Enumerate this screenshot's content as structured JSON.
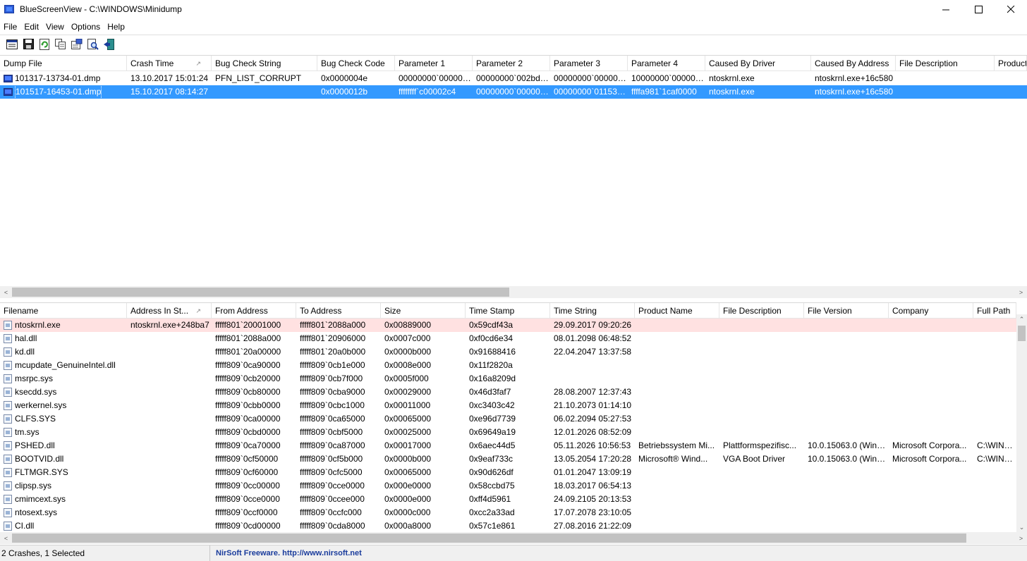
{
  "window": {
    "title": "BlueScreenView  -  C:\\WINDOWS\\Minidump",
    "minimize_glyph": "—",
    "maximize_glyph": "☐",
    "close_glyph": "✕"
  },
  "menu": {
    "items": [
      "File",
      "Edit",
      "View",
      "Options",
      "Help"
    ]
  },
  "toolbar": {
    "buttons": [
      "properties-list-icon",
      "save-icon",
      "refresh-icon",
      "copy-icon",
      "advanced-options-icon",
      "find-icon",
      "exit-icon"
    ]
  },
  "crash_list": {
    "columns": [
      {
        "label": "Dump File"
      },
      {
        "label": "Crash Time",
        "sort": "↗"
      },
      {
        "label": "Bug Check String"
      },
      {
        "label": "Bug Check Code"
      },
      {
        "label": "Parameter 1"
      },
      {
        "label": "Parameter 2"
      },
      {
        "label": "Parameter 3"
      },
      {
        "label": "Parameter 4"
      },
      {
        "label": "Caused By Driver"
      },
      {
        "label": "Caused By Address"
      },
      {
        "label": "File Description"
      },
      {
        "label": "Product"
      }
    ],
    "rows": [
      {
        "selected": false,
        "cells": [
          "101317-13734-01.dmp",
          "13.10.2017 15:01:24",
          "PFN_LIST_CORRUPT",
          "0x0000004e",
          "00000000`000000...",
          "00000000`002bde...",
          "00000000`000000...",
          "10000000`000000...",
          "ntoskrnl.exe",
          "ntoskrnl.exe+16c580",
          "",
          ""
        ]
      },
      {
        "selected": true,
        "cells": [
          "101517-16453-01.dmp",
          "15.10.2017 08:14:27",
          "",
          "0x0000012b",
          "ffffffff`c00002c4",
          "00000000`000008...",
          "00000000`01153a...",
          "ffffa981`1caf0000",
          "ntoskrnl.exe",
          "ntoskrnl.exe+16c580",
          "",
          ""
        ]
      }
    ]
  },
  "driver_list": {
    "columns": [
      {
        "label": "Filename"
      },
      {
        "label": "Address In St...",
        "sort": "↗"
      },
      {
        "label": "From Address"
      },
      {
        "label": "To Address"
      },
      {
        "label": "Size"
      },
      {
        "label": "Time Stamp"
      },
      {
        "label": "Time String"
      },
      {
        "label": "Product Name"
      },
      {
        "label": "File Description"
      },
      {
        "label": "File Version"
      },
      {
        "label": "Company"
      },
      {
        "label": "Full Path"
      }
    ],
    "rows": [
      {
        "highlight": true,
        "cells": [
          "ntoskrnl.exe",
          "ntoskrnl.exe+248ba7",
          "fffff801`20001000",
          "fffff801`2088a000",
          "0x00889000",
          "0x59cdf43a",
          "29.09.2017 09:20:26",
          "",
          "",
          "",
          "",
          ""
        ]
      },
      {
        "highlight": false,
        "cells": [
          "hal.dll",
          "",
          "fffff801`2088a000",
          "fffff801`20906000",
          "0x0007c000",
          "0xf0cd6e34",
          "08.01.2098 06:48:52",
          "",
          "",
          "",
          "",
          ""
        ]
      },
      {
        "highlight": false,
        "cells": [
          "kd.dll",
          "",
          "fffff801`20a00000",
          "fffff801`20a0b000",
          "0x0000b000",
          "0x91688416",
          "22.04.2047 13:37:58",
          "",
          "",
          "",
          "",
          ""
        ]
      },
      {
        "highlight": false,
        "cells": [
          "mcupdate_GenuineIntel.dll",
          "",
          "fffff809`0ca90000",
          "fffff809`0cb1e000",
          "0x0008e000",
          "0x11f2820a",
          "",
          "",
          "",
          "",
          "",
          ""
        ]
      },
      {
        "highlight": false,
        "cells": [
          "msrpc.sys",
          "",
          "fffff809`0cb20000",
          "fffff809`0cb7f000",
          "0x0005f000",
          "0x16a8209d",
          "",
          "",
          "",
          "",
          "",
          ""
        ]
      },
      {
        "highlight": false,
        "cells": [
          "ksecdd.sys",
          "",
          "fffff809`0cb80000",
          "fffff809`0cba9000",
          "0x00029000",
          "0x46d3faf7",
          "28.08.2007 12:37:43",
          "",
          "",
          "",
          "",
          ""
        ]
      },
      {
        "highlight": false,
        "cells": [
          "werkernel.sys",
          "",
          "fffff809`0cbb0000",
          "fffff809`0cbc1000",
          "0x00011000",
          "0xc3403c42",
          "21.10.2073 01:14:10",
          "",
          "",
          "",
          "",
          ""
        ]
      },
      {
        "highlight": false,
        "cells": [
          "CLFS.SYS",
          "",
          "fffff809`0ca00000",
          "fffff809`0ca65000",
          "0x00065000",
          "0xe96d7739",
          "06.02.2094 05:27:53",
          "",
          "",
          "",
          "",
          ""
        ]
      },
      {
        "highlight": false,
        "cells": [
          "tm.sys",
          "",
          "fffff809`0cbd0000",
          "fffff809`0cbf5000",
          "0x00025000",
          "0x69649a19",
          "12.01.2026 08:52:09",
          "",
          "",
          "",
          "",
          ""
        ]
      },
      {
        "highlight": false,
        "cells": [
          "PSHED.dll",
          "",
          "fffff809`0ca70000",
          "fffff809`0ca87000",
          "0x00017000",
          "0x6aec44d5",
          "05.11.2026 10:56:53",
          "Betriebssystem Mi...",
          "Plattformspezifisc...",
          "10.0.15063.0 (WinB...",
          "Microsoft Corpora...",
          "C:\\WINDO"
        ]
      },
      {
        "highlight": false,
        "cells": [
          "BOOTVID.dll",
          "",
          "fffff809`0cf50000",
          "fffff809`0cf5b000",
          "0x0000b000",
          "0x9eaf733c",
          "13.05.2054 17:20:28",
          "Microsoft® Wind...",
          "VGA Boot Driver",
          "10.0.15063.0 (WinB...",
          "Microsoft Corpora...",
          "C:\\WINDO"
        ]
      },
      {
        "highlight": false,
        "cells": [
          "FLTMGR.SYS",
          "",
          "fffff809`0cf60000",
          "fffff809`0cfc5000",
          "0x00065000",
          "0x90d626df",
          "01.01.2047 13:09:19",
          "",
          "",
          "",
          "",
          ""
        ]
      },
      {
        "highlight": false,
        "cells": [
          "clipsp.sys",
          "",
          "fffff809`0cc00000",
          "fffff809`0cce0000",
          "0x000e0000",
          "0x58ccbd75",
          "18.03.2017 06:54:13",
          "",
          "",
          "",
          "",
          ""
        ]
      },
      {
        "highlight": false,
        "cells": [
          "cmimcext.sys",
          "",
          "fffff809`0cce0000",
          "fffff809`0ccee000",
          "0x0000e000",
          "0xff4d5961",
          "24.09.2105 20:13:53",
          "",
          "",
          "",
          "",
          ""
        ]
      },
      {
        "highlight": false,
        "cells": [
          "ntosext.sys",
          "",
          "fffff809`0ccf0000",
          "fffff809`0ccfc000",
          "0x0000c000",
          "0xcc2a33ad",
          "17.07.2078 23:10:05",
          "",
          "",
          "",
          "",
          ""
        ]
      },
      {
        "highlight": false,
        "cells": [
          "CI.dll",
          "",
          "fffff809`0cd00000",
          "fffff809`0cda8000",
          "0x000a8000",
          "0x57c1e861",
          "27.08.2016 21:22:09",
          "",
          "",
          "",
          "",
          ""
        ]
      }
    ]
  },
  "scrollbars": {
    "left_arrow": "<",
    "right_arrow": ">",
    "up_arrow": "⌃",
    "down_arrow": "⌄"
  },
  "status": {
    "count_text": "2 Crashes, 1 Selected",
    "link_text": "NirSoft Freeware.  http://www.nirsoft.net"
  }
}
